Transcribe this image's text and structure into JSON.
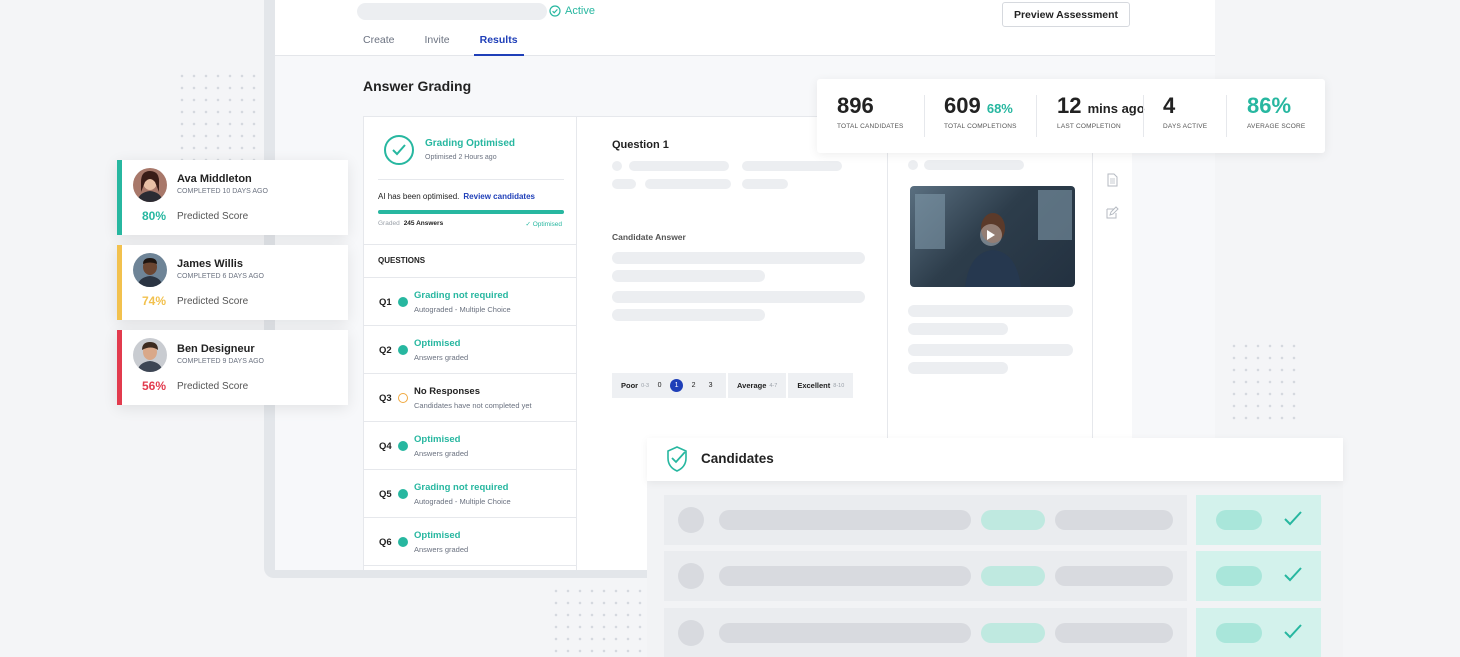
{
  "header": {
    "status": "Active",
    "preview_button": "Preview Assessment",
    "tabs": [
      {
        "label": "Create",
        "active": false
      },
      {
        "label": "Invite",
        "active": false
      },
      {
        "label": "Results",
        "active": true
      }
    ]
  },
  "page_title": "Answer Grading",
  "grading": {
    "title": "Grading Optimised",
    "subtitle": "Optimised 2 Hours ago",
    "ai_text": "AI has been optimised.",
    "ai_link": "Review candidates",
    "graded_label": "Graded",
    "graded_count": "245 Answers",
    "graded_status": "✓ Optimised",
    "progress": 1.0
  },
  "questions_header": "QUESTIONS",
  "questions": [
    {
      "num": "Q1",
      "title": "Grading not required",
      "sub": "Autograded - Multiple Choice",
      "state": "ok"
    },
    {
      "num": "Q2",
      "title": "Optimised",
      "sub": "Answers graded",
      "state": "ok"
    },
    {
      "num": "Q3",
      "title": "No Responses",
      "sub": "Candidates have not completed yet",
      "state": "warn"
    },
    {
      "num": "Q4",
      "title": "Optimised",
      "sub": "Answers graded",
      "state": "ok"
    },
    {
      "num": "Q5",
      "title": "Grading not required",
      "sub": "Autograded - Multiple Choice",
      "state": "ok"
    },
    {
      "num": "Q6",
      "title": "Optimised",
      "sub": "Answers graded",
      "state": "ok"
    }
  ],
  "question_panel": {
    "title": "Question 1",
    "candidate_answer_label": "Candidate Answer",
    "rating": {
      "poor": "Poor",
      "poor_range": "0-3",
      "numbers": [
        "0",
        "1",
        "2",
        "3"
      ],
      "selected": "1",
      "average": "Average",
      "average_range": "4-7",
      "excellent": "Excellent",
      "excellent_range": "8-10"
    }
  },
  "stats": [
    {
      "value": "896",
      "suffix": "",
      "label": "TOTAL CANDIDATES"
    },
    {
      "value": "609",
      "suffix": "68%",
      "label": "TOTAL COMPLETIONS"
    },
    {
      "value": "12",
      "suffix": "mins ago",
      "label": "LAST COMPLETION"
    },
    {
      "value": "4",
      "suffix": "",
      "label": "DAYS ACTIVE"
    },
    {
      "value": "86%",
      "suffix": "",
      "label": "AVERAGE SCORE"
    }
  ],
  "candidates": [
    {
      "name": "Ava Middleton",
      "completed": "COMPLETED 10 DAYS AGO",
      "score": "80%",
      "score_label": "Predicted Score",
      "color": "#27b7a0"
    },
    {
      "name": "James Willis",
      "completed": "COMPLETED 6 DAYS AGO",
      "score": "74%",
      "score_label": "Predicted Score",
      "color": "#f2c14e"
    },
    {
      "name": "Ben Designeur",
      "completed": "COMPLETED 9 DAYS AGO",
      "score": "56%",
      "score_label": "Predicted Score",
      "color": "#e23b4e"
    }
  ],
  "candidates_panel": {
    "title": "Candidates"
  },
  "colors": {
    "accent": "#27b7a0",
    "primary": "#1f3fb8",
    "warning": "#f0a940"
  },
  "icons": [
    "check-circle-icon",
    "play-icon",
    "document-icon",
    "edit-icon",
    "shield-check-icon",
    "checkmark-icon"
  ]
}
